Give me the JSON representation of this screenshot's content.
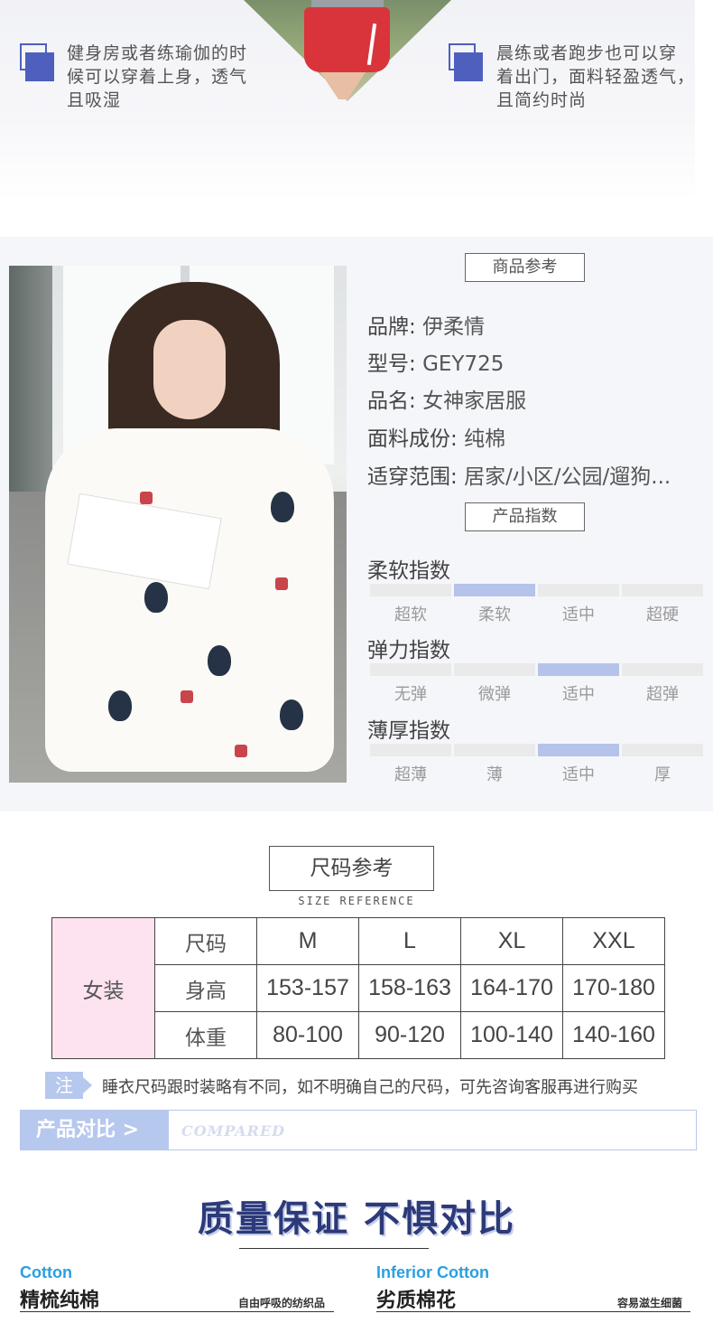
{
  "banner": {
    "left_text": [
      "健身房或者练瑜伽的时",
      "候可以穿着上身，透气",
      "且吸湿"
    ],
    "right_text": [
      "晨练或者跑步也可以穿",
      "着出门，面料轻盈透气，",
      "且简约时尚"
    ]
  },
  "product": {
    "reference_label": "商品参考",
    "specs": [
      {
        "label": "品牌:",
        "value": "伊柔情"
      },
      {
        "label": "型号:",
        "value": "GEY725"
      },
      {
        "label": "品名:",
        "value": "女神家居服"
      },
      {
        "label": "面料成份:",
        "value": "纯棉"
      },
      {
        "label": "适穿范围:",
        "value": "居家/小区/公园/遛狗..."
      }
    ],
    "index_label": "产品指数",
    "indices": [
      {
        "title": "柔软指数",
        "options": [
          "超软",
          "柔软",
          "适中",
          "超硬"
        ],
        "selected": 1
      },
      {
        "title": "弹力指数",
        "options": [
          "无弹",
          "微弹",
          "适中",
          "超弹"
        ],
        "selected": 2
      },
      {
        "title": "薄厚指数",
        "options": [
          "超薄",
          "薄",
          "适中",
          "厚"
        ],
        "selected": 2
      }
    ]
  },
  "size": {
    "title": "尺码参考",
    "subtitle": "SIZE REFERENCE",
    "category": "女装",
    "header": [
      "尺码",
      "M",
      "L",
      "XL",
      "XXL"
    ],
    "rows": [
      [
        "身高",
        "153-157",
        "158-163",
        "164-170",
        "170-180"
      ],
      [
        "体重",
        "80-100",
        "90-120",
        "100-140",
        "140-160"
      ]
    ],
    "note_tag": "注",
    "note": "睡衣尺码跟时装略有不同，如不明确自己的尺码，可先咨询客服再进行购买"
  },
  "compare": {
    "label": "产品对比 >",
    "label_en": "COMPARED",
    "slogan": "质量保证 不惧对比",
    "left": {
      "en": "Cotton",
      "cn": "精梳纯棉",
      "tag": "自由呼吸的纺织品"
    },
    "right": {
      "en": "Inferior Cotton",
      "cn": "劣质棉花",
      "tag": "容易滋生细菌"
    }
  },
  "colors": {
    "accent": "#4e5fbd",
    "soft_blue": "#b7c8ee",
    "pink": "#fde3ef",
    "index_on": "#b5c3ea"
  }
}
